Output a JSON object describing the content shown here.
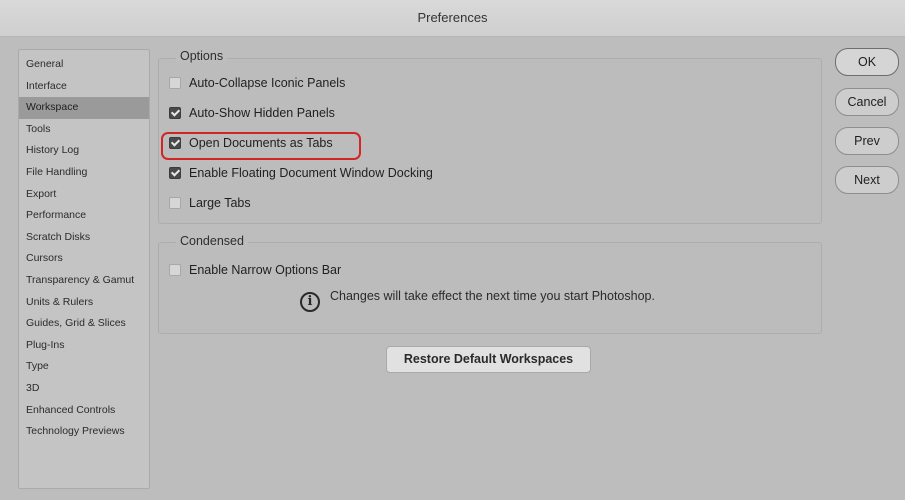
{
  "window": {
    "title": "Preferences"
  },
  "sidebar": {
    "items": [
      {
        "label": "General"
      },
      {
        "label": "Interface"
      },
      {
        "label": "Workspace"
      },
      {
        "label": "Tools"
      },
      {
        "label": "History Log"
      },
      {
        "label": "File Handling"
      },
      {
        "label": "Export"
      },
      {
        "label": "Performance"
      },
      {
        "label": "Scratch Disks"
      },
      {
        "label": "Cursors"
      },
      {
        "label": "Transparency & Gamut"
      },
      {
        "label": "Units & Rulers"
      },
      {
        "label": "Guides, Grid & Slices"
      },
      {
        "label": "Plug-Ins"
      },
      {
        "label": "Type"
      },
      {
        "label": "3D"
      },
      {
        "label": "Enhanced Controls"
      },
      {
        "label": "Technology Previews"
      }
    ],
    "selected": "Workspace"
  },
  "options": {
    "title": "Options",
    "items": [
      {
        "label": "Auto-Collapse Iconic Panels",
        "checked": false
      },
      {
        "label": "Auto-Show Hidden Panels",
        "checked": true
      },
      {
        "label": "Open Documents as Tabs",
        "checked": true
      },
      {
        "label": "Enable Floating Document Window Docking",
        "checked": true
      },
      {
        "label": "Large Tabs",
        "checked": false
      }
    ]
  },
  "condensed": {
    "title": "Condensed",
    "items": [
      {
        "label": "Enable Narrow Options Bar",
        "checked": false
      }
    ],
    "info_text": "Changes will take effect the next time you start Photoshop."
  },
  "restore_button": "Restore Default Workspaces",
  "buttons": {
    "ok": "OK",
    "cancel": "Cancel",
    "prev": "Prev",
    "next": "Next"
  },
  "colors": {
    "highlight": "#d22525"
  }
}
